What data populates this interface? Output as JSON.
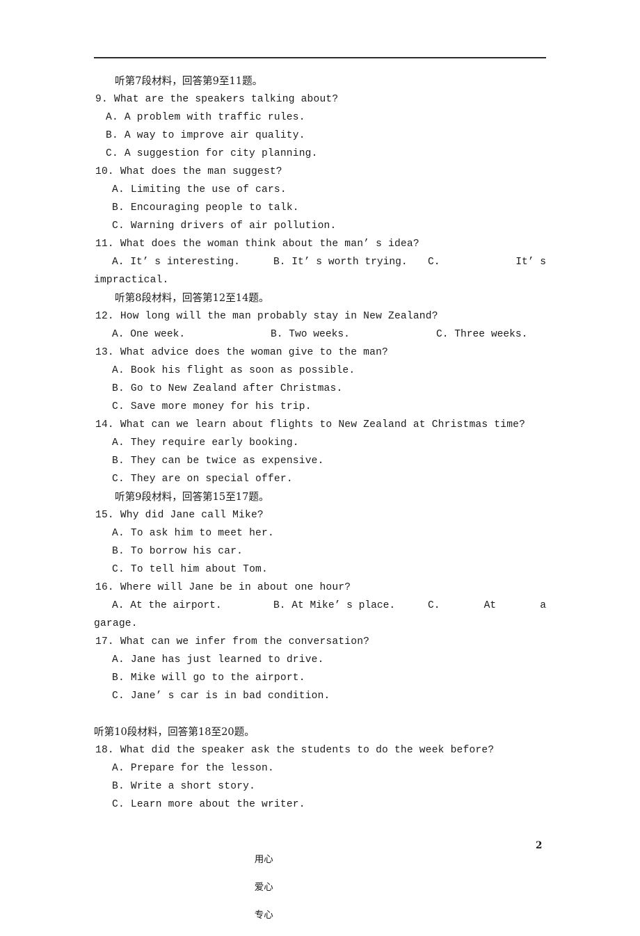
{
  "document": {
    "page_number": "2",
    "footer_words": [
      "用心",
      "爱心",
      "专心"
    ]
  },
  "sections": {
    "heading_7": "听第7段材料，回答第9至11题。",
    "heading_8": "听第8段材料，回答第12至14题。",
    "heading_9": "听第9段材料，回答第15至17题。",
    "heading_10": "听第10段材料，回答第18至20题。"
  },
  "questions": [
    {
      "number": "9.",
      "stem": "9. What are the speakers talking about?",
      "options": [
        "A. A problem with traffic rules.",
        "B. A way to improve air quality.",
        "C. A suggestion for city planning."
      ]
    },
    {
      "number": "10.",
      "stem": "10. What does the man suggest?",
      "options": [
        "A. Limiting the use of cars.",
        "B. Encouraging people to talk.",
        "C. Warning drivers of air pollution."
      ]
    },
    {
      "number": "11.",
      "stem": "11. What does the woman think about the man’ s idea?",
      "inline_options": {
        "a": "A. It’ s interesting.",
        "b": "B. It’ s worth trying.",
        "c_lead": "C.",
        "c_mid": "It’ s",
        "c_wrap": "impractical."
      }
    },
    {
      "number": "12.",
      "stem": "12. How long will the man probably stay in New Zealand?",
      "inline_options": {
        "a": "A. One week.",
        "b": "B. Two weeks.",
        "c": "C. Three weeks."
      }
    },
    {
      "number": "13.",
      "stem": "13. What advice does the woman give to the man?",
      "options": [
        "A. Book his flight as soon as possible.",
        "B. Go to New Zealand after Christmas.",
        "C. Save more money for his trip."
      ]
    },
    {
      "number": "14.",
      "stem": "14. What can we learn about flights to New Zealand at Christmas time?",
      "options": [
        "A. They require early booking.",
        "B. They can be twice as expensive.",
        "C. They are on special offer."
      ]
    },
    {
      "number": "15.",
      "stem": "15. Why did Jane call Mike?",
      "options": [
        "A. To ask him to meet her.",
        "B. To borrow his car.",
        "C. To tell him about Tom."
      ]
    },
    {
      "number": "16.",
      "stem": "16. Where will Jane be in about one hour?",
      "inline_options": {
        "a": "A. At the airport.",
        "b": "B. At Mike’ s place.",
        "c_lead": "C.",
        "c_mid": "At",
        "c_tail": "a",
        "c_wrap": "garage."
      }
    },
    {
      "number": "17.",
      "stem": "17. What can we infer from the conversation?",
      "options": [
        "A. Jane has just learned to drive.",
        "B. Mike will go to the airport.",
        "C. Jane’ s car is in bad condition."
      ]
    },
    {
      "number": "18.",
      "stem": "18. What did the speaker ask the students to do the week before?",
      "options": [
        "A. Prepare for the lesson.",
        "B. Write a short story.",
        "C. Learn more about the writer."
      ]
    }
  ]
}
